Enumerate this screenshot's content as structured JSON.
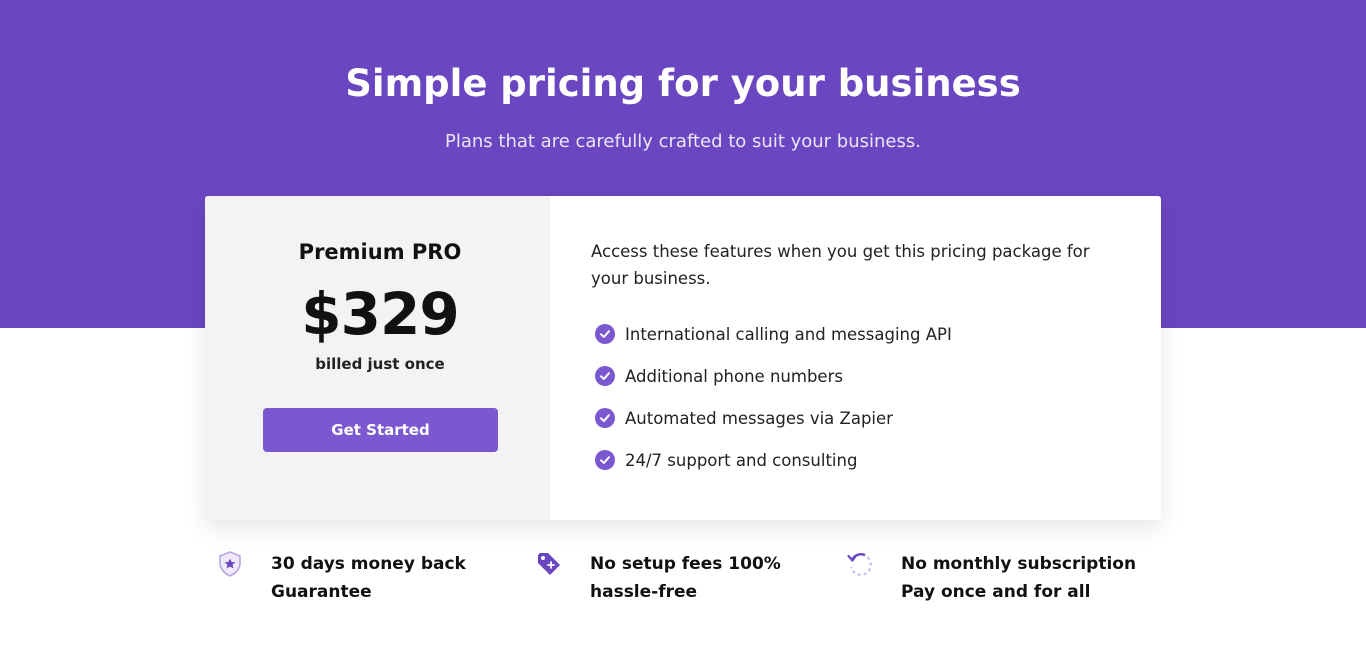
{
  "hero": {
    "title": "Simple pricing for your business",
    "subtitle": "Plans that are carefully crafted to suit your business."
  },
  "plan": {
    "name": "Premium PRO",
    "price": "$329",
    "billing": "billed just once",
    "cta_label": "Get Started"
  },
  "features": {
    "intro": "Access these features when you get this pricing package for your business.",
    "items": [
      {
        "label": "International calling and messaging API",
        "icon": "check-circle-icon"
      },
      {
        "label": "Additional phone numbers",
        "icon": "check-circle-icon"
      },
      {
        "label": "Automated messages via Zapier",
        "icon": "check-circle-icon"
      },
      {
        "label": "24/7 support and consulting",
        "icon": "check-circle-icon"
      }
    ]
  },
  "perks": [
    {
      "label": "30 days money back Guarantee",
      "icon": "shield-star-icon"
    },
    {
      "label": "No setup fees 100% hassle-free",
      "icon": "price-tag-icon"
    },
    {
      "label": "No monthly subscription Pay once and for all",
      "icon": "refresh-icon"
    }
  ],
  "colors": {
    "brand": "#6a46c1",
    "accent": "#7b58cf",
    "card_left_bg": "#f3f3f3"
  }
}
